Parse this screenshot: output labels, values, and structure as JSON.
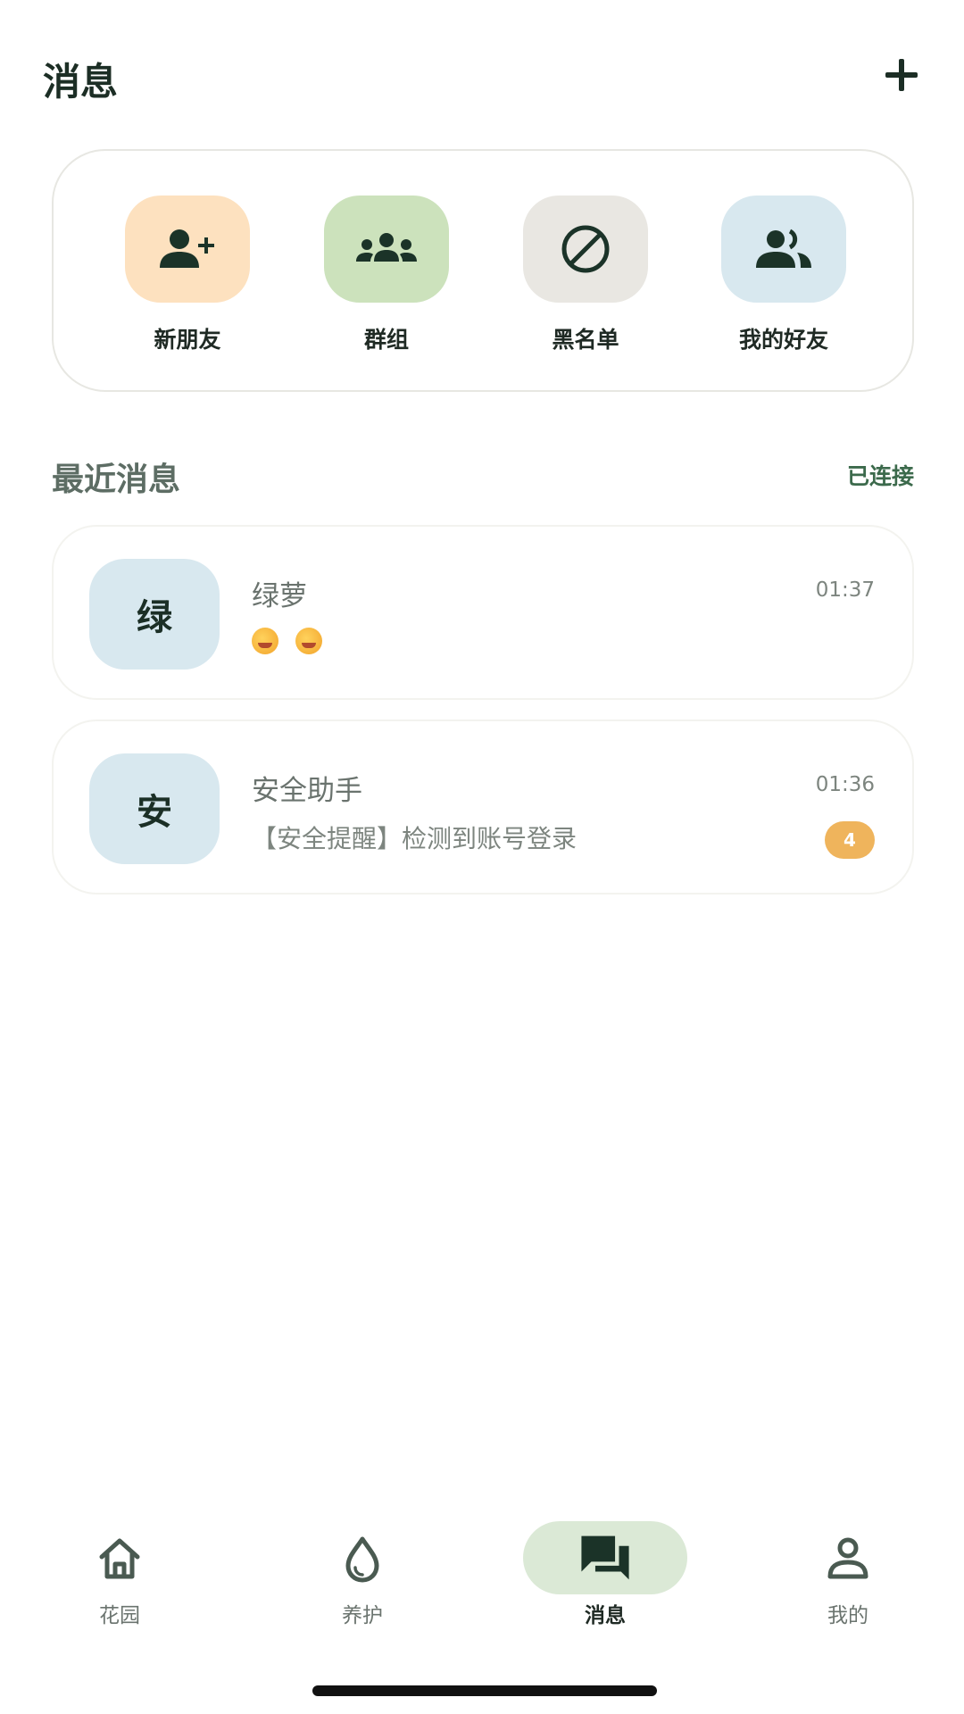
{
  "header": {
    "title": "消息",
    "add_icon": "plus-icon"
  },
  "quick_actions": [
    {
      "label": "新朋友",
      "icon": "person-add-icon",
      "color": "#fde1bf"
    },
    {
      "label": "群组",
      "icon": "group-icon",
      "color": "#cce2bc"
    },
    {
      "label": "黑名单",
      "icon": "block-icon",
      "color": "#e9e7e2"
    },
    {
      "label": "我的好友",
      "icon": "friends-icon",
      "color": "#d8e8ef"
    }
  ],
  "recent": {
    "title": "最近消息",
    "status": "已连接"
  },
  "chats": [
    {
      "avatar_text": "绿",
      "name": "绿萝",
      "time": "01:37",
      "preview_emoji": [
        "smiling-face-with-hearts-emoji",
        "smiling-face-with-hearts-emoji"
      ],
      "preview": ""
    },
    {
      "avatar_text": "安",
      "name": "安全助手",
      "time": "01:36",
      "preview": "【安全提醒】检测到账号登录",
      "unread": "4"
    }
  ],
  "nav": [
    {
      "label": "花园",
      "icon": "home-icon",
      "active": false
    },
    {
      "label": "养护",
      "icon": "water-drop-icon",
      "active": false
    },
    {
      "label": "消息",
      "icon": "chat-icon",
      "active": true
    },
    {
      "label": "我的",
      "icon": "person-icon",
      "active": false
    }
  ],
  "colors": {
    "primary": "#1c2e25",
    "accent_green": "#dbe9d6",
    "badge": "#efb45c"
  }
}
